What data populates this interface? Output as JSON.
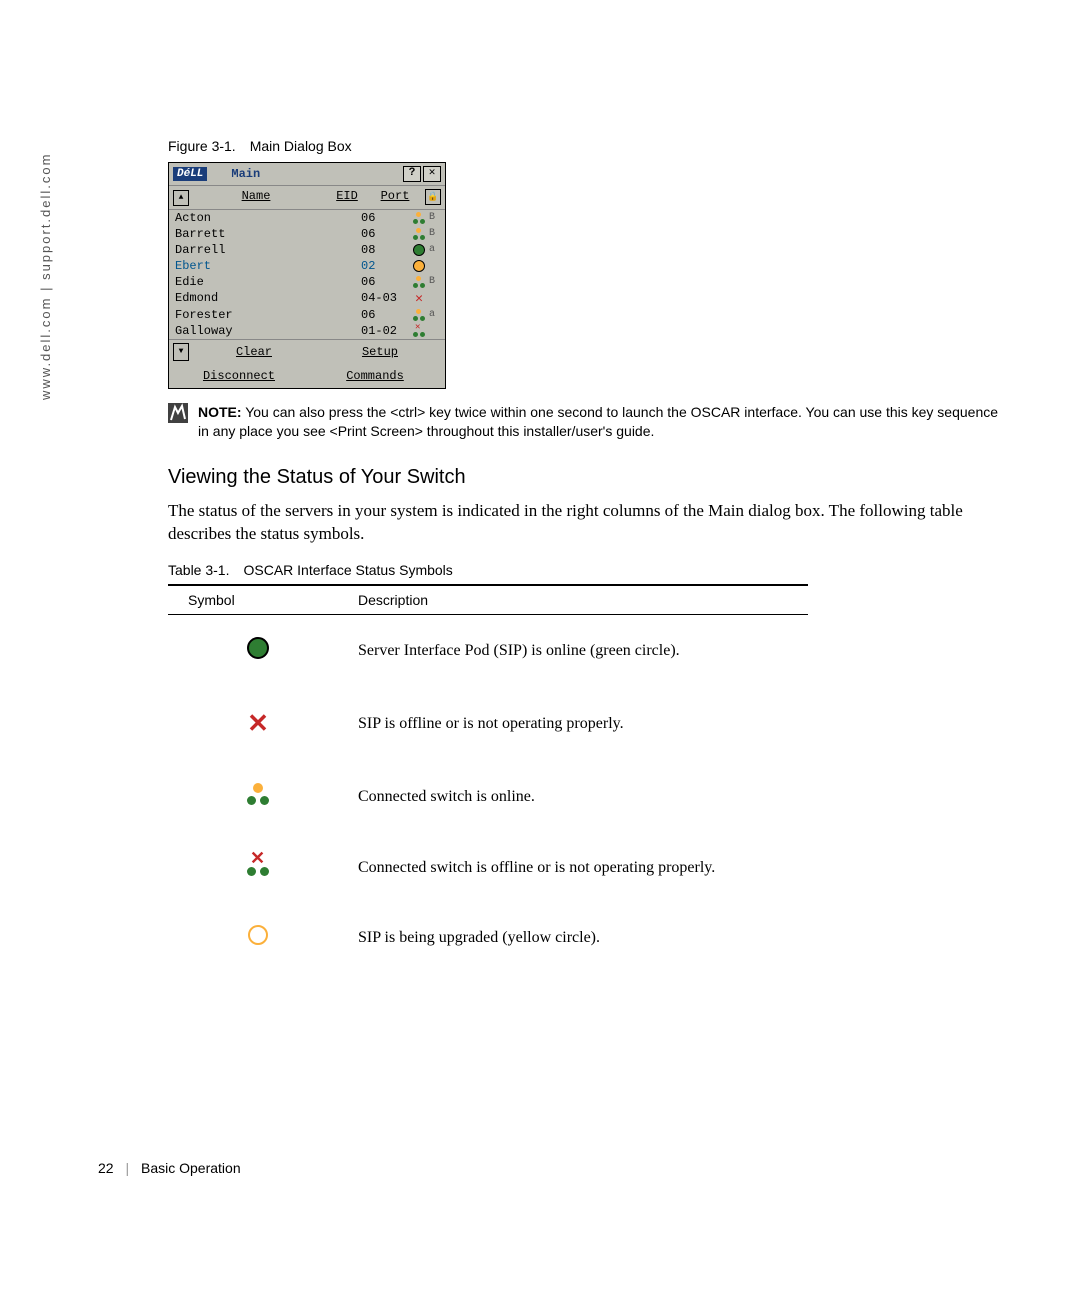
{
  "side_url": "www.dell.com | support.dell.com",
  "figure_caption": "Figure 3-1. Main Dialog Box",
  "dialog": {
    "brand": "DéLL",
    "title": "Main",
    "help": "?",
    "close": "✕",
    "headers": {
      "name": "Name",
      "eid": "EID",
      "port": "Port"
    },
    "rows": [
      {
        "name": "Acton",
        "port": "06",
        "icon": "switch-on",
        "ch": "B"
      },
      {
        "name": "Barrett",
        "port": "06",
        "icon": "switch-on",
        "ch": "B"
      },
      {
        "name": "Darrell",
        "port": "08",
        "icon": "circle-g",
        "ch": "a"
      },
      {
        "name": "Ebert",
        "port": "02",
        "icon": "circle-y",
        "ch": "",
        "sel": true
      },
      {
        "name": "Edie",
        "port": "06",
        "icon": "switch-on",
        "ch": "B"
      },
      {
        "name": "Edmond",
        "port": "04-03",
        "icon": "x-red",
        "ch": ""
      },
      {
        "name": "Forester",
        "port": "06",
        "icon": "switch-on",
        "ch": "a"
      },
      {
        "name": "Galloway",
        "port": "01-02",
        "icon": "switch-off",
        "ch": ""
      }
    ],
    "buttons": {
      "clear": "Clear",
      "setup": "Setup",
      "disconnect": "Disconnect",
      "commands": "Commands"
    }
  },
  "note_label": "NOTE:",
  "note_text": "You can also press the <ctrl> key twice within one second to launch the OSCAR interface. You can use this key sequence in any place you see <Print Screen> throughout this installer/user's guide.",
  "section_heading": "Viewing the Status of Your Switch",
  "body_text": "The status of the servers in your system is indicated in the right columns of the Main dialog box. The following table describes the status symbols.",
  "table_caption": "Table 3-1. OSCAR Interface Status Symbols",
  "table": {
    "head": {
      "symbol": "Symbol",
      "description": "Description"
    },
    "rows": [
      {
        "sym": "green-circle",
        "desc": "Server Interface Pod (SIP) is online (green circle)."
      },
      {
        "sym": "red-x",
        "desc": "SIP is offline or is not operating properly."
      },
      {
        "sym": "sw-on",
        "desc": "Connected switch is online."
      },
      {
        "sym": "sw-off",
        "desc": "Connected switch is offline or is not operating properly."
      },
      {
        "sym": "yellow-circle",
        "desc": "SIP is being upgraded (yellow circle)."
      }
    ]
  },
  "footer": {
    "page": "22",
    "section": "Basic Operation"
  }
}
